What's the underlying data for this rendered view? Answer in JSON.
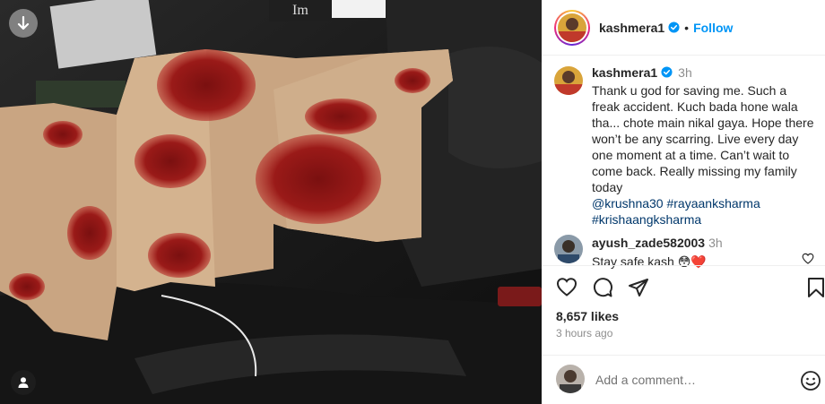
{
  "post": {
    "username": "kashmera1",
    "follow_label": "Follow",
    "dot": "•"
  },
  "caption": {
    "username": "kashmera1",
    "time": "3h",
    "text": "Thank u god for saving me. Such a freak accident. Kuch bada hone wala tha... chote main nikal gaya. Hope there won’t be any scarring. Live every day one moment at a time. Can’t wait to come back. Really missing my family today",
    "mentions": [
      "@krushna30 #rayaanksharma",
      "#krishaangksharma"
    ]
  },
  "comment": {
    "username": "ayush_zade582003",
    "time": "3h",
    "text": "Stay safe kash 😳❤️"
  },
  "stats": {
    "likes": "8,657 likes",
    "posted": "3 hours ago"
  },
  "add_comment": {
    "placeholder": "Add a comment…"
  },
  "icons": {
    "carousel": "arrow-down-icon",
    "tagged": "user-tag-icon",
    "like": "heart-icon",
    "comment": "comment-icon",
    "share": "send-icon",
    "save": "bookmark-icon",
    "emoji": "smiley-icon",
    "verified": "verified-badge-icon"
  },
  "colors": {
    "accent": "#0095f6",
    "verified": "#0095f6",
    "hashtag": "#00376b",
    "muted": "#8e8e8e"
  }
}
